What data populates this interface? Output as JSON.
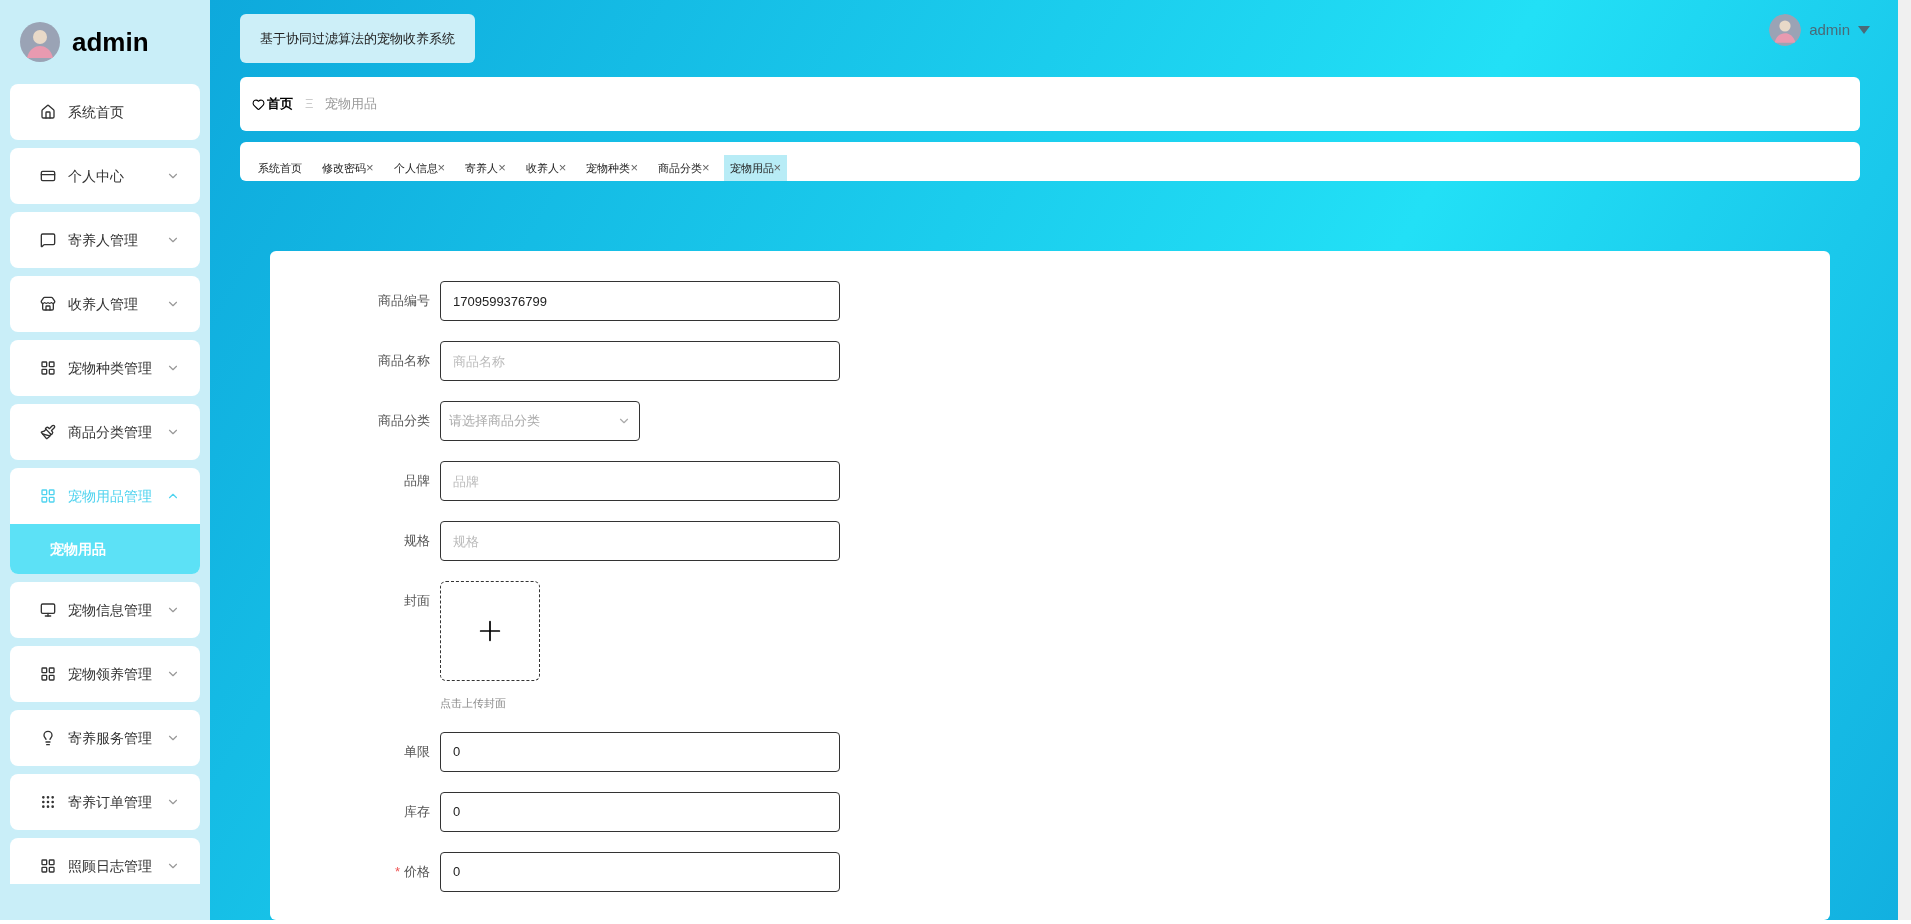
{
  "brand": {
    "name": "admin"
  },
  "sidebar": {
    "items": [
      {
        "kind": "home",
        "label": "系统首页",
        "expandable": false,
        "expanded": false
      },
      {
        "kind": "card",
        "label": "个人中心",
        "expandable": true,
        "expanded": false
      },
      {
        "kind": "chat",
        "label": "寄养人管理",
        "expandable": true,
        "expanded": false
      },
      {
        "kind": "store",
        "label": "收养人管理",
        "expandable": true,
        "expanded": false
      },
      {
        "kind": "grid",
        "label": "宠物种类管理",
        "expandable": true,
        "expanded": false
      },
      {
        "kind": "brush",
        "label": "商品分类管理",
        "expandable": true,
        "expanded": false
      },
      {
        "kind": "grid",
        "label": "宠物用品管理",
        "expandable": true,
        "expanded": true,
        "children": [
          {
            "label": "宠物用品",
            "selected": true
          }
        ]
      },
      {
        "kind": "monitor",
        "label": "宠物信息管理",
        "expandable": true,
        "expanded": false
      },
      {
        "kind": "grid",
        "label": "宠物领养管理",
        "expandable": true,
        "expanded": false
      },
      {
        "kind": "bulb",
        "label": "寄养服务管理",
        "expandable": true,
        "expanded": false
      },
      {
        "kind": "apps",
        "label": "寄养订单管理",
        "expandable": true,
        "expanded": false
      },
      {
        "kind": "grid",
        "label": "照顾日志管理",
        "expandable": true,
        "expanded": false
      }
    ]
  },
  "header": {
    "system_title": "基于协同过滤算法的宠物收养系统",
    "user": "admin"
  },
  "breadcrumb": {
    "home": "首页",
    "separator": "Ξ",
    "current": "宠物用品"
  },
  "tabs": [
    {
      "label": "系统首页",
      "closable": false,
      "selected": false
    },
    {
      "label": "修改密码",
      "closable": true,
      "selected": false
    },
    {
      "label": "个人信息",
      "closable": true,
      "selected": false
    },
    {
      "label": "寄养人",
      "closable": true,
      "selected": false
    },
    {
      "label": "收养人",
      "closable": true,
      "selected": false
    },
    {
      "label": "宠物种类",
      "closable": true,
      "selected": false
    },
    {
      "label": "商品分类",
      "closable": true,
      "selected": false
    },
    {
      "label": "宠物用品",
      "closable": true,
      "selected": true
    }
  ],
  "close_glyph": "×",
  "form": {
    "fields": [
      {
        "kind": "input",
        "label": "商品编号",
        "value": "1709599376799",
        "required": false
      },
      {
        "kind": "input",
        "label": "商品名称",
        "placeholder": "商品名称",
        "required": false
      },
      {
        "kind": "select",
        "label": "商品分类",
        "placeholder": "请选择商品分类",
        "required": false
      },
      {
        "kind": "input",
        "label": "品牌",
        "placeholder": "品牌",
        "required": false
      },
      {
        "kind": "input",
        "label": "规格",
        "placeholder": "规格",
        "required": false
      },
      {
        "kind": "upload",
        "label": "封面",
        "hint": "点击上传封面",
        "required": false
      },
      {
        "kind": "input",
        "label": "单限",
        "value": "0",
        "required": false
      },
      {
        "kind": "input",
        "label": "库存",
        "value": "0",
        "required": false
      },
      {
        "kind": "input",
        "label": "价格",
        "value": "0",
        "required": true
      }
    ],
    "required_mark": "*"
  }
}
